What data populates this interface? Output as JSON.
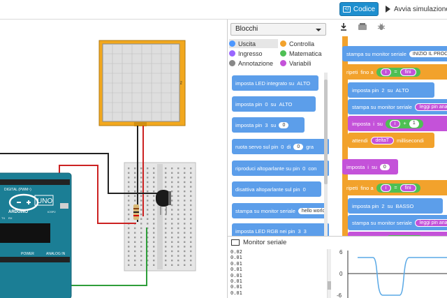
{
  "toolbar": {
    "code_label": "Codice",
    "simulate_label": "Avvia simulazione"
  },
  "panel": {
    "mode_select": "Blocchi",
    "categories": [
      {
        "label": "Uscita",
        "color": "#4c97ff"
      },
      {
        "label": "Ingresso",
        "color": "#9966ff"
      },
      {
        "label": "Annotazione",
        "color": "#888888"
      },
      {
        "label": "Controlla",
        "color": "#f2a22c"
      },
      {
        "label": "Matematica",
        "color": "#4fbf54"
      },
      {
        "label": "Variabili",
        "color": "#c452d9"
      }
    ],
    "palette_blocks": [
      {
        "text": "imposta LED integrato su",
        "values": [
          "ALTO"
        ]
      },
      {
        "text": "imposta pin",
        "values": [
          "0",
          "su",
          "ALTO"
        ]
      },
      {
        "text": "imposta pin",
        "values": [
          "3",
          "su",
          "0"
        ]
      },
      {
        "text": "ruota servo sul pin",
        "values": [
          "0",
          "di",
          "0",
          "gra"
        ]
      },
      {
        "text": "riproduci altoparlante su pin",
        "values": [
          "0",
          "con"
        ]
      },
      {
        "text": "disattiva altoparlante sul pin",
        "values": [
          "0"
        ]
      },
      {
        "text": "stampa su monitor seriale",
        "values": [
          "hello world"
        ]
      },
      {
        "text": "imposta LED RGB nei pin",
        "values": [
          "3",
          "3"
        ]
      }
    ]
  },
  "workspace": {
    "blocks": [
      {
        "kind": "blue",
        "text": "stampa su monitor seriale",
        "value": "INIZIO IL PROCE"
      },
      {
        "kind": "orange",
        "text": "ripeti",
        "value": "fino a",
        "cond": [
          "i",
          "=",
          "fini"
        ]
      },
      {
        "kind": "blue",
        "text": "imposta pin",
        "value": "2",
        "tail": "su",
        "tail2": "ALTO"
      },
      {
        "kind": "blue",
        "text": "stampa su monitor seriale",
        "value": "leggi pin anal"
      },
      {
        "kind": "purple",
        "text": "imposta",
        "value": "i",
        "tail": "su",
        "expr": [
          "i",
          "+",
          "1"
        ]
      },
      {
        "kind": "orange",
        "text": "attendi",
        "value": "deltaT",
        "tail": "millisecondi"
      },
      {
        "kind": "purple",
        "text": "imposta",
        "value": "i",
        "tail": "su",
        "tail2": "0"
      },
      {
        "kind": "orange",
        "text": "ripeti",
        "value": "fino a",
        "cond": [
          "i",
          "=",
          "fini"
        ]
      },
      {
        "kind": "blue",
        "text": "imposta pin",
        "value": "2",
        "tail": "su",
        "tail2": "BASSO"
      },
      {
        "kind": "blue",
        "text": "stampa su monitor seriale",
        "value": "leggi pin anal"
      },
      {
        "kind": "purple",
        "text": "imposta",
        "value": "i",
        "tail": "su",
        "expr": [
          "i",
          "+",
          "1"
        ]
      }
    ]
  },
  "serial": {
    "title": "Monitor seriale",
    "log": [
      "0.02",
      "0.01",
      "0.01",
      "0.01",
      "0.01",
      "0.01",
      "0.01",
      "0.01",
      "0.01"
    ],
    "plot_ticks": [
      "6",
      "0",
      "-6"
    ]
  },
  "components": {
    "board_label": "UNO",
    "board_brand": "ARDUINO",
    "digital_label": "DIGITAL (PWM~)",
    "power_label": "POWER",
    "analog_label": "ANALOG IN",
    "icsp_label": "ICSP2",
    "tx_label": "TX",
    "rx_label": "RX",
    "lcd_tag": "Rd"
  }
}
